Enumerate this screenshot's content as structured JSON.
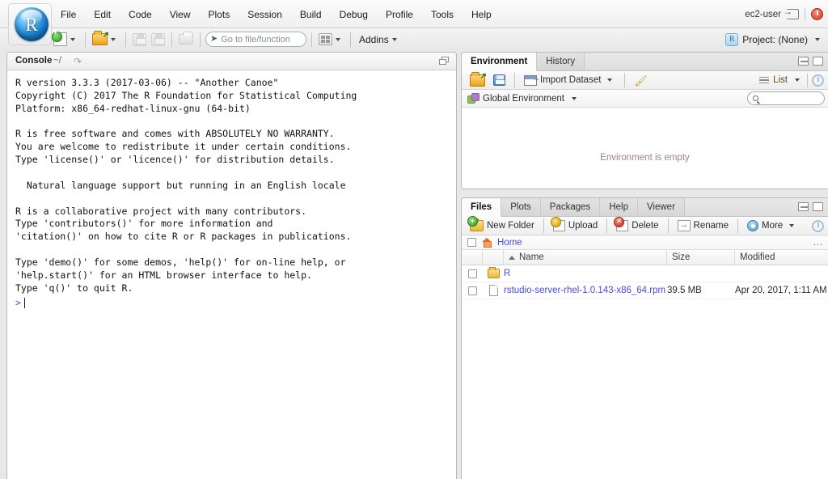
{
  "app": {
    "logo_letter": "R"
  },
  "menubar": {
    "items": [
      {
        "label": "File"
      },
      {
        "label": "Edit"
      },
      {
        "label": "Code"
      },
      {
        "label": "View"
      },
      {
        "label": "Plots"
      },
      {
        "label": "Session"
      },
      {
        "label": "Build"
      },
      {
        "label": "Debug"
      },
      {
        "label": "Profile"
      },
      {
        "label": "Tools"
      },
      {
        "label": "Help"
      }
    ],
    "user": "ec2-user"
  },
  "toolbar": {
    "goto_placeholder": "Go to file/function",
    "addins_label": "Addins",
    "project_label": "Project: (None)"
  },
  "console": {
    "title": "Console",
    "path": "~/",
    "text": "R version 3.3.3 (2017-03-06) -- \"Another Canoe\"\nCopyright (C) 2017 The R Foundation for Statistical Computing\nPlatform: x86_64-redhat-linux-gnu (64-bit)\n\nR is free software and comes with ABSOLUTELY NO WARRANTY.\nYou are welcome to redistribute it under certain conditions.\nType 'license()' or 'licence()' for distribution details.\n\n  Natural language support but running in an English locale\n\nR is a collaborative project with many contributors.\nType 'contributors()' for more information and\n'citation()' on how to cite R or R packages in publications.\n\nType 'demo()' for some demos, 'help()' for on-line help, or\n'help.start()' for an HTML browser interface to help.\nType 'q()' to quit R.",
    "prompt": ">"
  },
  "environment": {
    "tabs": [
      {
        "label": "Environment",
        "active": true
      },
      {
        "label": "History",
        "active": false
      }
    ],
    "toolbar": {
      "import_label": "Import Dataset",
      "list_label": "List"
    },
    "scope_label": "Global Environment",
    "search_value": "",
    "empty_message": "Environment is empty"
  },
  "files": {
    "tabs": [
      {
        "label": "Files",
        "active": true
      },
      {
        "label": "Plots",
        "active": false
      },
      {
        "label": "Packages",
        "active": false
      },
      {
        "label": "Help",
        "active": false
      },
      {
        "label": "Viewer",
        "active": false
      }
    ],
    "toolbar": {
      "new_folder": "New Folder",
      "upload": "Upload",
      "delete": "Delete",
      "rename": "Rename",
      "more": "More"
    },
    "path_label": "Home",
    "path_overflow": "...",
    "columns": [
      "",
      "",
      "Name",
      "Size",
      "Modified"
    ],
    "rows": [
      {
        "name": "R",
        "size": "",
        "modified": "",
        "kind": "folder"
      },
      {
        "name": "rstudio-server-rhel-1.0.143-x86_64.rpm",
        "size": "39.5 MB",
        "modified": "Apr 20, 2017, 1:11 AM",
        "kind": "file"
      }
    ]
  },
  "colors": {
    "accent_blue": "#4a4ad6",
    "prompt_blue": "#3c5ccf",
    "empty_text": "#9a8383"
  }
}
